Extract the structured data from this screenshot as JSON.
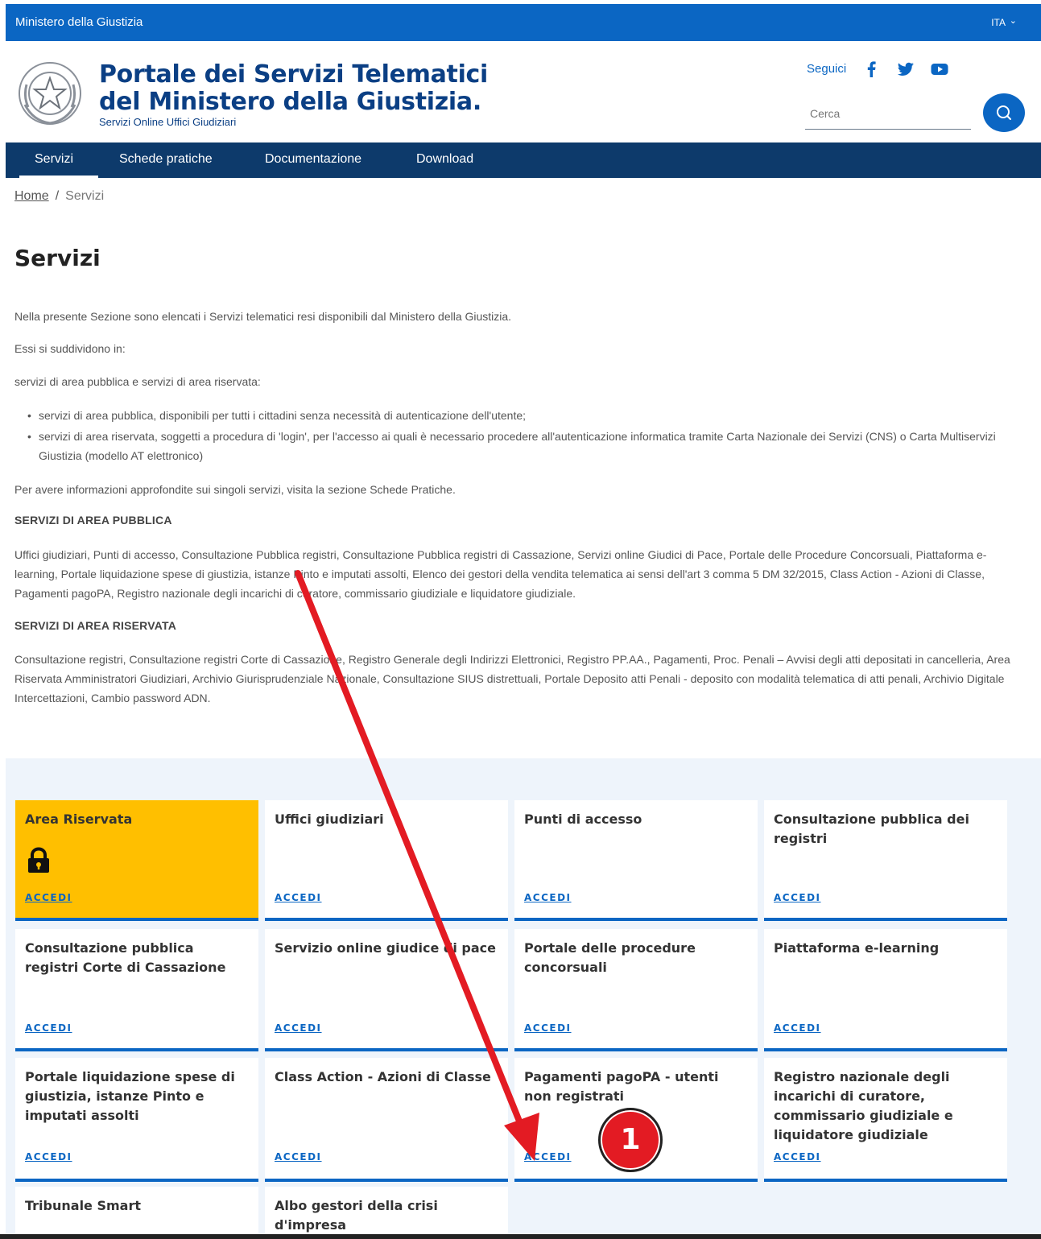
{
  "topbar": {
    "ministry": "Ministero della Giustizia",
    "language": "ITA"
  },
  "header": {
    "title_line1": "Portale dei Servizi Telematici",
    "title_line2": "del Ministero della Giustizia.",
    "subtitle": "Servizi Online Uffici Giudiziari",
    "follow_label": "Seguici",
    "social_icons": [
      "facebook-icon",
      "twitter-icon",
      "youtube-icon"
    ],
    "search_placeholder": "Cerca"
  },
  "nav": {
    "items": [
      "Servizi",
      "Schede pratiche",
      "Documentazione",
      "Download"
    ],
    "active": "Servizi"
  },
  "breadcrumb": {
    "home": "Home",
    "sep": "/",
    "current": "Servizi"
  },
  "page": {
    "title": "Servizi",
    "intro": "Nella presente Sezione sono elencati i Servizi telematici resi disponibili dal Ministero della Giustizia.",
    "divided": "Essi si suddividono in:",
    "types": "servizi di area pubblica e servizi di area riservata:",
    "bullets": [
      "servizi di area pubblica, disponibili per tutti i cittadini senza necessità di autenticazione dell'utente;",
      "servizi di area riservata, soggetti a procedura di 'login', per l'accesso ai quali è necessario procedere all'autenticazione informatica tramite Carta Nazionale dei Servizi (CNS) o Carta Multiservizi Giustizia (modello AT elettronico)"
    ],
    "info": "Per avere informazioni approfondite sui singoli servizi, visita la sezione Schede Pratiche.",
    "public_heading": "SERVIZI DI AREA PUBBLICA",
    "public_text": "Uffici giudiziari, Punti di accesso, Consultazione Pubblica registri, Consultazione Pubblica registri di Cassazione, Servizi online Giudici di Pace, Portale delle Procedure Concorsuali, Piattaforma e-learning, Portale liquidazione spese di giustizia, istanze Pinto e imputati assolti, Elenco dei gestori della vendita telematica ai sensi dell'art 3 comma 5 DM 32/2015, Class Action - Azioni di Classe, Pagamenti pagoPA, Registro nazionale degli incarichi di curatore, commissario giudiziale e liquidatore giudiziale.",
    "reserved_heading": "SERVIZI DI AREA RISERVATA",
    "reserved_text": "Consultazione registri, Consultazione registri Corte di Cassazione, Registro Generale degli Indirizzi Elettronici, Registro PP.AA., Pagamenti, Proc. Penali – Avvisi degli atti depositati in cancelleria, Area Riservata Amministratori Giudiziari, Archivio Giurisprudenziale Nazionale, Consultazione SIUS distrettuali, Portale Deposito atti Penali - deposito con modalità telematica di atti penali, Archivio Digitale Intercettazioni, Cambio password ADN."
  },
  "cards": {
    "link_label": "ACCEDI",
    "items": [
      "Area Riservata",
      "Uffici giudiziari",
      "Punti di accesso",
      "Consultazione pubblica dei registri",
      "Consultazione pubblica registri Corte di Cassazione",
      "Servizio online giudice di pace",
      "Portale delle procedure concorsuali",
      "Piattaforma e-learning",
      "Portale liquidazione spese di giustizia, istanze Pinto e imputati assolti",
      "Class Action - Azioni di Classe",
      "Pagamenti pagoPA - utenti non registrati",
      "Registro nazionale degli incarichi di curatore, commissario giudiziale e liquidatore giudiziale",
      "Tribunale Smart",
      "Albo gestori della crisi d'impresa"
    ]
  },
  "annotation": {
    "marker": "1",
    "color": "#e31b23"
  },
  "colors": {
    "brand_blue": "#0b66c3",
    "nav_dark": "#0d3a6b",
    "highlight_yellow": "#ffbf00"
  }
}
